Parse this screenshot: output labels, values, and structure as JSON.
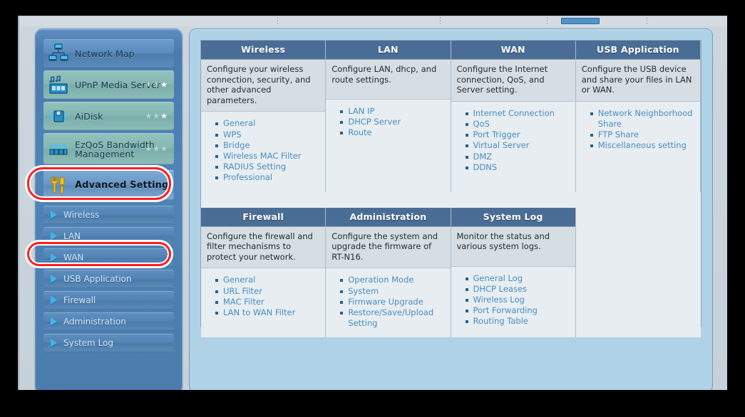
{
  "window": {
    "toolbar_present": true
  },
  "sidebar": {
    "items": [
      {
        "label": "Network Map",
        "icon": "network-map-icon",
        "style": "blue",
        "stars": null
      },
      {
        "label": "UPnP Media Server",
        "icon": "media-server-icon",
        "style": "teal",
        "stars": {
          "total": 3,
          "lit": 1
        }
      },
      {
        "label": "AiDisk",
        "icon": "aidisk-icon",
        "style": "teal",
        "stars": {
          "total": 3,
          "lit": 1
        }
      },
      {
        "label": "EzQoS Bandwidth Management",
        "icon": "ezqos-icon",
        "style": "teal",
        "stars": {
          "total": 3,
          "lit": 0
        }
      }
    ],
    "advanced": {
      "label": "Advanced Setting",
      "icon": "tools-icon",
      "selected": true
    },
    "sub_items": [
      {
        "label": "Wireless",
        "selected": false
      },
      {
        "label": "LAN",
        "selected": false
      },
      {
        "label": "WAN",
        "selected": true
      },
      {
        "label": "USB Application",
        "selected": false
      },
      {
        "label": "Firewall",
        "selected": false
      },
      {
        "label": "Administration",
        "selected": false
      },
      {
        "label": "System Log",
        "selected": false
      }
    ]
  },
  "main": {
    "row1": [
      {
        "title": "Wireless",
        "description": "Configure your wireless connection, security, and other advanced parameters.",
        "links": [
          "General",
          "WPS",
          "Bridge",
          "Wireless MAC Filter",
          "RADIUS Setting",
          "Professional"
        ]
      },
      {
        "title": "LAN",
        "description": "Configure LAN, dhcp, and route settings.",
        "links": [
          "LAN IP",
          "DHCP Server",
          "Route"
        ]
      },
      {
        "title": "WAN",
        "description": "Configure the Internet connection, QoS, and Server setting.",
        "links": [
          "Internet Connection",
          "QoS",
          "Port Trigger",
          "Virtual Server",
          "DMZ",
          "DDNS"
        ]
      },
      {
        "title": "USB Application",
        "description": "Configure the USB device and share your files in LAN or WAN.",
        "links": [
          "Network Neighborhood Share",
          "FTP Share",
          "Miscellaneous setting"
        ]
      }
    ],
    "row2": [
      {
        "title": "Firewall",
        "description": "Configure the firewall and filter mechanisms to protect your network.",
        "links": [
          "General",
          "URL Filter",
          "MAC Filter",
          "LAN to WAN Filter"
        ]
      },
      {
        "title": "Administration",
        "description": "Configure the system and upgrade the firmware of RT-N16.",
        "links": [
          "Operation Mode",
          "System",
          "Firmware Upgrade",
          "Restore/Save/Upload Setting"
        ]
      },
      {
        "title": "System Log",
        "description": "Monitor the status and various system logs.",
        "links": [
          "General Log",
          "DHCP Leases",
          "Wireless Log",
          "Port Forwarding",
          "Routing Table"
        ]
      }
    ]
  },
  "annotations": {
    "highlights": [
      {
        "target": "advanced-setting",
        "color": "#ff2020"
      },
      {
        "target": "wan",
        "color": "#ff2020"
      }
    ]
  },
  "colors": {
    "card_header": "#4a6d96",
    "card_desc_bg": "#d6dee4",
    "card_links_bg": "#e7edf1",
    "link": "#4a8ec2",
    "panel_bg": "#b0d2e6",
    "sidebar_blue": "#5a8ab9",
    "sidebar_teal": "#8bbbb6",
    "highlight": "#ff2020"
  }
}
